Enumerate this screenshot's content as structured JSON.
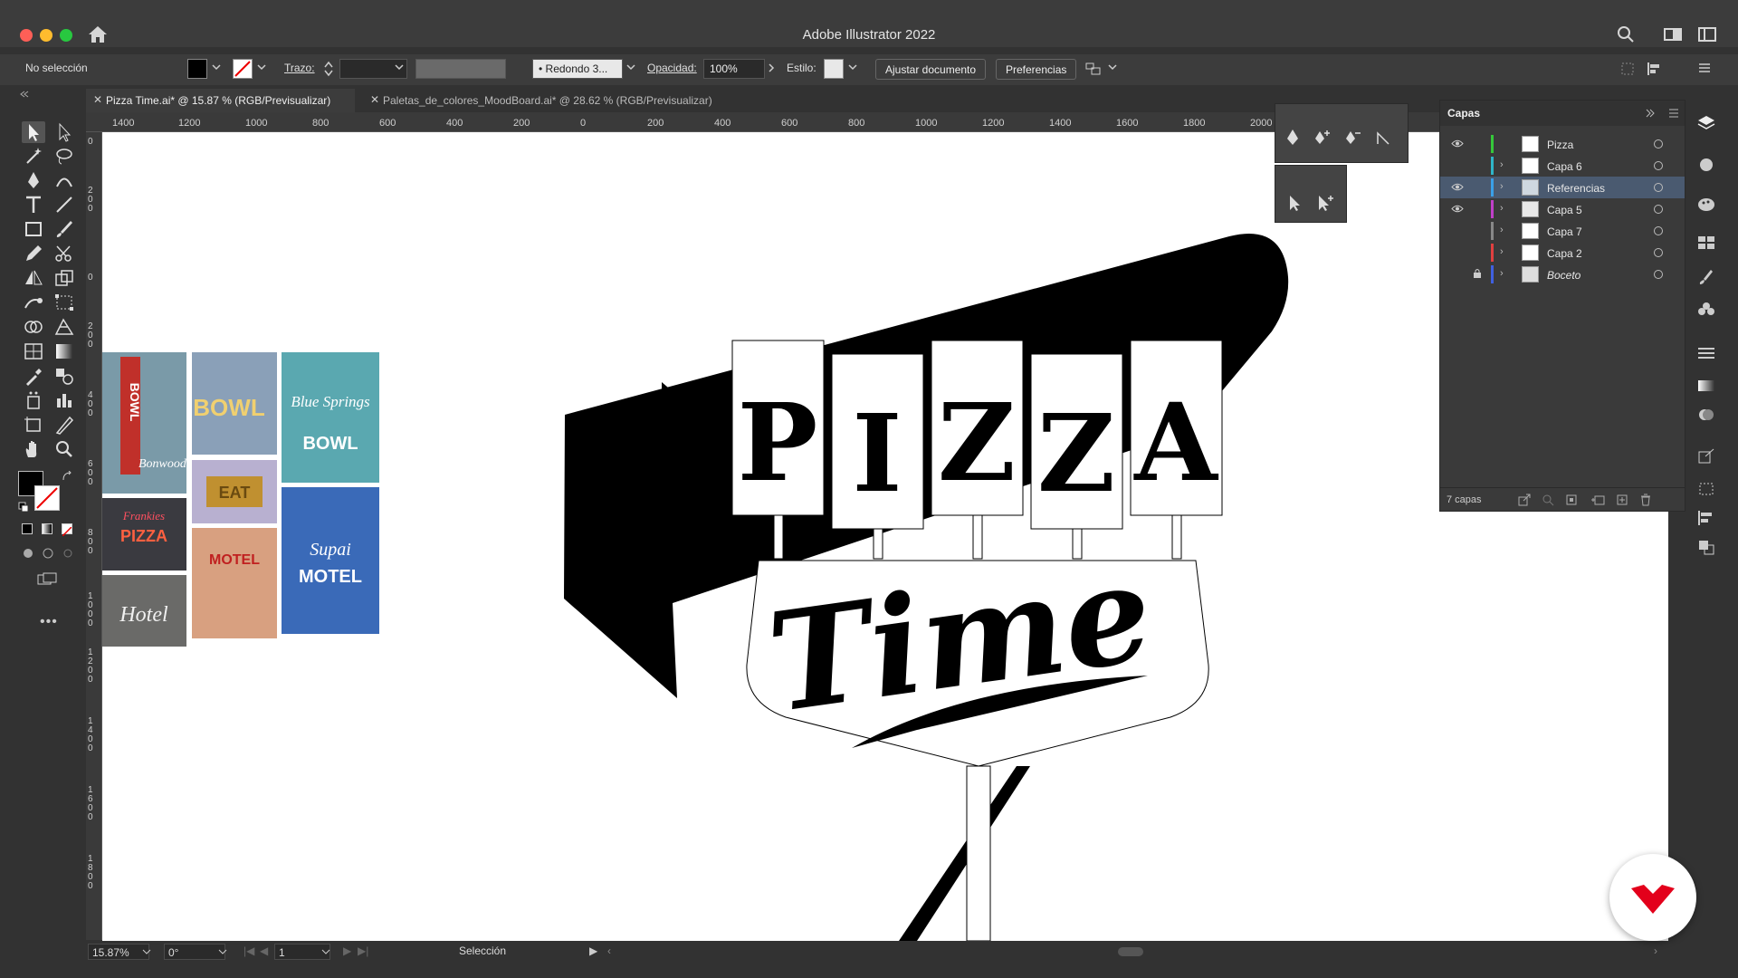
{
  "app": {
    "title": "Adobe Illustrator 2022"
  },
  "controlbar": {
    "selection_status": "No selección",
    "stroke_label": "Trazo:",
    "brush_label": "Redondo 3...",
    "opacity_label": "Opacidad:",
    "opacity_value": "100%",
    "style_label": "Estilo:",
    "fit_doc_button": "Ajustar documento",
    "prefs_button": "Preferencias"
  },
  "tabs": [
    {
      "label": "Pizza Time.ai* @ 15.87 % (RGB/Previsualizar)",
      "active": true
    },
    {
      "label": "Paletas_de_colores_MoodBoard.ai* @ 28.62 % (RGB/Previsualizar)",
      "active": false
    }
  ],
  "ruler": {
    "h_labels": [
      "1400",
      "1200",
      "1000",
      "800",
      "600",
      "400",
      "200",
      "0",
      "200",
      "400",
      "600",
      "800",
      "1000",
      "1200",
      "1400",
      "1600",
      "1800",
      "2000"
    ],
    "v_labels": [
      "0",
      "200",
      "0",
      "200",
      "400",
      "600",
      "800",
      "1000",
      "1200",
      "1400",
      "1600",
      "1800"
    ]
  },
  "artwork": {
    "letters": [
      "P",
      "I",
      "Z",
      "Z",
      "A"
    ],
    "script_word": "Time"
  },
  "moodboard": {
    "photo_texts": [
      "BOWL",
      "Bonwood",
      "BOWL",
      "Blue Springs",
      "BOWL",
      "EAT",
      "Frankies",
      "PIZZA",
      "Hotel",
      "MOTEL",
      "Supai",
      "MOTEL"
    ]
  },
  "layers_panel": {
    "title": "Capas",
    "layers": [
      {
        "name": "Pizza",
        "color": "#35c83a",
        "visible": true,
        "locked": false,
        "selected": false,
        "expandable": false
      },
      {
        "name": "Capa 6",
        "color": "#2fb5c8",
        "visible": false,
        "locked": false,
        "selected": false,
        "expandable": true
      },
      {
        "name": "Referencias",
        "color": "#3aa0e8",
        "visible": true,
        "locked": false,
        "selected": true,
        "expandable": true
      },
      {
        "name": "Capa 5",
        "color": "#c040c8",
        "visible": true,
        "locked": false,
        "selected": false,
        "expandable": true
      },
      {
        "name": "Capa 7",
        "color": "#888888",
        "visible": false,
        "locked": false,
        "selected": false,
        "expandable": true
      },
      {
        "name": "Capa 2",
        "color": "#e04040",
        "visible": false,
        "locked": false,
        "selected": false,
        "expandable": true
      },
      {
        "name": "Boceto",
        "color": "#4060e0",
        "visible": false,
        "locked": true,
        "selected": false,
        "expandable": true
      }
    ],
    "count_label": "7 capas"
  },
  "statusbar": {
    "zoom": "15.87%",
    "rotation": "0°",
    "artboard": "1",
    "tool": "Selección"
  },
  "colors": {
    "ui_dark": "#323232",
    "ui_panel": "#3a3a3a",
    "selection_highlight": "#4a5a70",
    "brand_red": "#e3001b"
  }
}
